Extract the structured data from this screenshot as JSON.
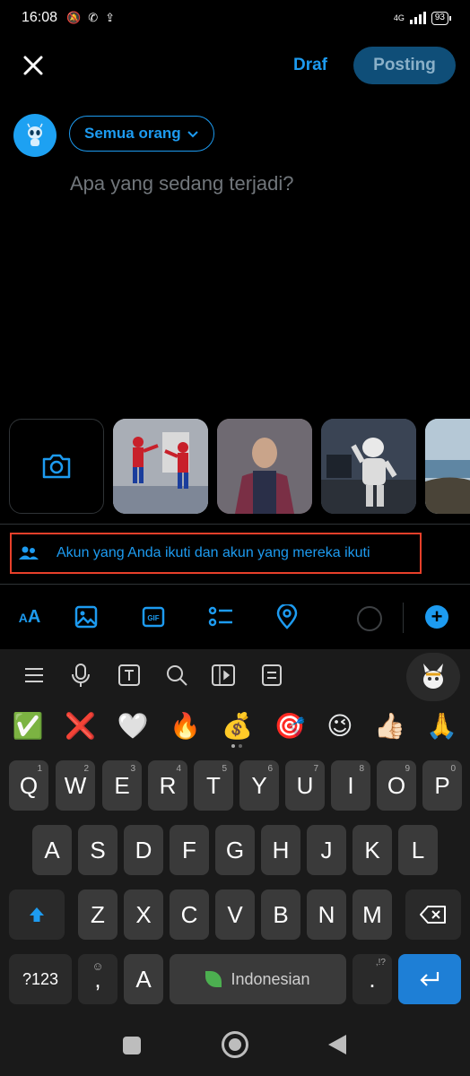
{
  "status_bar": {
    "time": "16:08",
    "network": "4G",
    "battery": "93"
  },
  "header": {
    "draft_label": "Draf",
    "post_label": "Posting"
  },
  "composer": {
    "audience_label": "Semua orang",
    "placeholder": "Apa yang sedang terjadi?"
  },
  "reply_setting": {
    "label": "Akun yang Anda ikuti dan akun yang mereka ikuti"
  },
  "toolbar": {
    "text_format_label_big": "A",
    "text_format_label_small": "A",
    "icons": [
      "text-format-icon",
      "image-icon",
      "gif-icon",
      "poll-icon",
      "location-icon"
    ],
    "gif_label": "GIF",
    "add_label": "+"
  },
  "keyboard": {
    "emojis": [
      "✅",
      "❌",
      "🤍",
      "🔥",
      "💰",
      "🎯",
      "😉",
      "👍🏻",
      "🙏"
    ],
    "row1": [
      {
        "k": "Q",
        "n": "1"
      },
      {
        "k": "W",
        "n": "2"
      },
      {
        "k": "E",
        "n": "3"
      },
      {
        "k": "R",
        "n": "4"
      },
      {
        "k": "T",
        "n": "5"
      },
      {
        "k": "Y",
        "n": "6"
      },
      {
        "k": "U",
        "n": "7"
      },
      {
        "k": "I",
        "n": "8"
      },
      {
        "k": "O",
        "n": "9"
      },
      {
        "k": "P",
        "n": "0"
      }
    ],
    "row2": [
      "A",
      "S",
      "D",
      "F",
      "G",
      "H",
      "J",
      "K",
      "L"
    ],
    "row3": [
      "Z",
      "X",
      "C",
      "V",
      "B",
      "N",
      "M"
    ],
    "symbols_label": "?123",
    "comma_label": ",",
    "a_label": "A",
    "space_label": "Indonesian",
    "period_label": ".",
    "period_hint": ",!?"
  },
  "colors": {
    "accent": "#1d9bf0",
    "highlight_border": "#e8402a",
    "enter_key": "#1e7fd6"
  }
}
